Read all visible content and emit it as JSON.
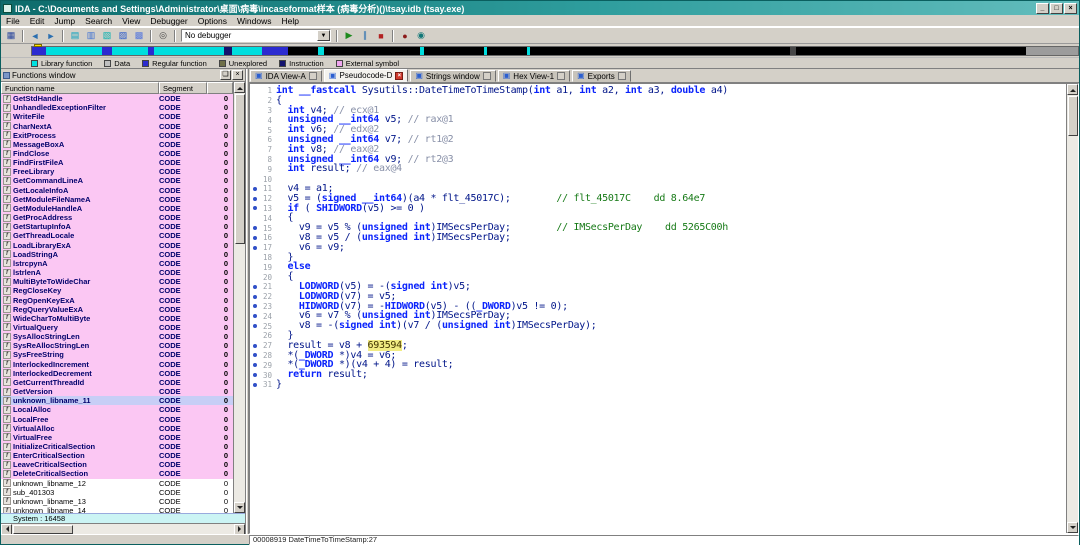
{
  "window": {
    "title": "IDA - C:\\Documents and Settings\\Administrator\\桌面\\病毒\\incaseformat样本 (病毒分析)()\\tsay.idb (tsay.exe)",
    "controls": [
      {
        "name": "minimize-button",
        "glyph": "_"
      },
      {
        "name": "maximize-button",
        "glyph": "□"
      },
      {
        "name": "close-button",
        "glyph": "×"
      }
    ]
  },
  "menu": {
    "items": [
      "File",
      "Edit",
      "Jump",
      "Search",
      "View",
      "Debugger",
      "Options",
      "Windows",
      "Help"
    ]
  },
  "toolbar": {
    "no_debugger": "No debugger",
    "combo_arrow": "▼",
    "items": [
      {
        "name": "save-icon",
        "glyph": "▦",
        "color": "#28459c"
      },
      {
        "sep": true
      },
      {
        "name": "back-icon",
        "glyph": "◄",
        "color": "#2b6fb0"
      },
      {
        "name": "forward-icon",
        "glyph": "►",
        "color": "#2b6fb0"
      },
      {
        "sep": true
      },
      {
        "name": "disasm-view-icon",
        "glyph": "▤",
        "color": "#00a0c0"
      },
      {
        "name": "hex-view-icon",
        "glyph": "▥",
        "color": "#3b6fd4"
      },
      {
        "name": "structures-view-icon",
        "glyph": "▧",
        "color": "#00b0b0"
      },
      {
        "name": "enums-view-icon",
        "glyph": "▨",
        "color": "#2255cc"
      },
      {
        "name": "imports-view-icon",
        "glyph": "▩",
        "color": "#5577dd"
      },
      {
        "sep": true
      },
      {
        "name": "search-icon",
        "glyph": "◎",
        "color": "#444444"
      },
      {
        "sep": true
      },
      {
        "combo": true
      },
      {
        "sep": true
      },
      {
        "name": "start-process-icon",
        "glyph": "▶",
        "color": "#1e8a1e"
      },
      {
        "name": "pause-process-icon",
        "glyph": "∥",
        "color": "#2b6fb0"
      },
      {
        "name": "stop-process-icon",
        "glyph": "■",
        "color": "#b22222"
      },
      {
        "sep": true
      },
      {
        "name": "breakpoints-icon",
        "glyph": "●",
        "color": "#8b1a1a"
      },
      {
        "name": "watches-icon",
        "glyph": "◉",
        "color": "#117777"
      }
    ]
  },
  "nav_band": {
    "segments": [
      [
        "#2b2bd0",
        14
      ],
      [
        "#00dede",
        56
      ],
      [
        "#2b2bd0",
        10
      ],
      [
        "#00dede",
        36
      ],
      [
        "#2b2bd0",
        6
      ],
      [
        "#00dede",
        70
      ],
      [
        "#14146e",
        8
      ],
      [
        "#00dede",
        30
      ],
      [
        "#2b2bd0",
        26
      ],
      [
        "#000000",
        30
      ],
      [
        "#00dede",
        6
      ],
      [
        "#000000",
        96
      ],
      [
        "#00dede",
        4
      ],
      [
        "#000000",
        60
      ],
      [
        "#00dede",
        3
      ],
      [
        "#000000",
        40
      ],
      [
        "#00dede",
        3
      ],
      [
        "#000000",
        260
      ],
      [
        "#464646",
        6
      ],
      [
        "#000000",
        230
      ],
      [
        "#9c9c9c",
        54
      ]
    ]
  },
  "legend": {
    "items": [
      {
        "label": "Library function",
        "color": "#00E0E0"
      },
      {
        "label": "Data",
        "color": "#BFBFBF"
      },
      {
        "label": "Regular function",
        "color": "#2B2BD0"
      },
      {
        "label": "Unexplored",
        "color": "#6E6E46"
      },
      {
        "label": "Instruction",
        "color": "#14146E"
      },
      {
        "label": "External symbol",
        "color": "#F0A6F0"
      }
    ]
  },
  "functions_panel": {
    "title": "Functions window",
    "columns": [
      "Function name",
      "Segment",
      ""
    ],
    "row_icon": "f",
    "buttons": [
      {
        "name": "panel-float-button",
        "glyph": "❏"
      },
      {
        "name": "panel-close-button",
        "glyph": "×"
      }
    ],
    "footer": "System : 16458",
    "rows": [
      [
        "GetStdHandle",
        "CODE",
        "0",
        "lib"
      ],
      [
        "UnhandledExceptionFilter",
        "CODE",
        "0",
        "lib"
      ],
      [
        "WriteFile",
        "CODE",
        "0",
        "lib"
      ],
      [
        "CharNextA",
        "CODE",
        "0",
        "lib"
      ],
      [
        "ExitProcess",
        "CODE",
        "0",
        "lib"
      ],
      [
        "MessageBoxA",
        "CODE",
        "0",
        "lib"
      ],
      [
        "FindClose",
        "CODE",
        "0",
        "lib"
      ],
      [
        "FindFirstFileA",
        "CODE",
        "0",
        "lib"
      ],
      [
        "FreeLibrary",
        "CODE",
        "0",
        "lib"
      ],
      [
        "GetCommandLineA",
        "CODE",
        "0",
        "lib"
      ],
      [
        "GetLocaleInfoA",
        "CODE",
        "0",
        "lib"
      ],
      [
        "GetModuleFileNameA",
        "CODE",
        "0",
        "lib"
      ],
      [
        "GetModuleHandleA",
        "CODE",
        "0",
        "lib"
      ],
      [
        "GetProcAddress",
        "CODE",
        "0",
        "lib"
      ],
      [
        "GetStartupInfoA",
        "CODE",
        "0",
        "lib"
      ],
      [
        "GetThreadLocale",
        "CODE",
        "0",
        "lib"
      ],
      [
        "LoadLibraryExA",
        "CODE",
        "0",
        "lib"
      ],
      [
        "LoadStringA",
        "CODE",
        "0",
        "lib"
      ],
      [
        "lstrcpynA",
        "CODE",
        "0",
        "lib"
      ],
      [
        "lstrlenA",
        "CODE",
        "0",
        "lib"
      ],
      [
        "MultiByteToWideChar",
        "CODE",
        "0",
        "lib"
      ],
      [
        "RegCloseKey",
        "CODE",
        "0",
        "lib"
      ],
      [
        "RegOpenKeyExA",
        "CODE",
        "0",
        "lib"
      ],
      [
        "RegQueryValueExA",
        "CODE",
        "0",
        "lib"
      ],
      [
        "WideCharToMultiByte",
        "CODE",
        "0",
        "lib"
      ],
      [
        "VirtualQuery",
        "CODE",
        "0",
        "lib"
      ],
      [
        "SysAllocStringLen",
        "CODE",
        "0",
        "lib"
      ],
      [
        "SysReAllocStringLen",
        "CODE",
        "0",
        "lib"
      ],
      [
        "SysFreeString",
        "CODE",
        "0",
        "lib"
      ],
      [
        "InterlockedIncrement",
        "CODE",
        "0",
        "lib"
      ],
      [
        "InterlockedDecrement",
        "CODE",
        "0",
        "lib"
      ],
      [
        "GetCurrentThreadId",
        "CODE",
        "0",
        "lib"
      ],
      [
        "GetVersion",
        "CODE",
        "0",
        "lib"
      ],
      [
        "unknown_libname_11",
        "CODE",
        "0",
        "sel"
      ],
      [
        "LocalAlloc",
        "CODE",
        "0",
        "lib"
      ],
      [
        "LocalFree",
        "CODE",
        "0",
        "lib"
      ],
      [
        "VirtualAlloc",
        "CODE",
        "0",
        "lib"
      ],
      [
        "VirtualFree",
        "CODE",
        "0",
        "lib"
      ],
      [
        "InitializeCriticalSection",
        "CODE",
        "0",
        "lib"
      ],
      [
        "EnterCriticalSection",
        "CODE",
        "0",
        "lib"
      ],
      [
        "LeaveCriticalSection",
        "CODE",
        "0",
        "lib"
      ],
      [
        "DeleteCriticalSection",
        "CODE",
        "0",
        "lib"
      ],
      [
        "unknown_libname_12",
        "CODE",
        "0",
        "plain"
      ],
      [
        "sub_401303",
        "CODE",
        "0",
        "plain"
      ],
      [
        "unknown_libname_13",
        "CODE",
        "0",
        "plain"
      ],
      [
        "unknown_libname_14",
        "CODE",
        "0",
        "plain"
      ]
    ]
  },
  "tabs_meta": {
    "icon_glyph": "▣",
    "close_glyph": "×"
  },
  "tabs": [
    {
      "label": "IDA View-A",
      "active": false
    },
    {
      "label": "Pseudocode-D",
      "active": true
    },
    {
      "label": "Strings window",
      "active": false
    },
    {
      "label": "Hex View-1",
      "active": false
    },
    {
      "label": "Exports",
      "active": false
    }
  ],
  "pseudocode": {
    "keywords": [
      "__fastcall",
      "__int64",
      "unsigned",
      "signed",
      "double",
      "return",
      "SHIDWORD",
      "LODWORD",
      "HIDWORD",
      "_DWORD",
      "else",
      "int",
      "if"
    ],
    "highlight": "693594",
    "lines": [
      {
        "n": 1,
        "dot": 0,
        "t": "int __fastcall Sysutils::DateTimeToTimeStamp(int a1, int a2, int a3, double a4)"
      },
      {
        "n": 2,
        "dot": 0,
        "t": "{"
      },
      {
        "n": 3,
        "dot": 0,
        "t": "  int v4; // ecx@1"
      },
      {
        "n": 4,
        "dot": 0,
        "t": "  unsigned __int64 v5; // rax@1"
      },
      {
        "n": 5,
        "dot": 0,
        "t": "  int v6; // edx@2"
      },
      {
        "n": 6,
        "dot": 0,
        "t": "  unsigned __int64 v7; // rt1@2"
      },
      {
        "n": 7,
        "dot": 0,
        "t": "  int v8; // eax@2"
      },
      {
        "n": 8,
        "dot": 0,
        "t": "  unsigned __int64 v9; // rt2@3"
      },
      {
        "n": 9,
        "dot": 0,
        "t": "  int result; // eax@4"
      },
      {
        "n": 10,
        "dot": 0,
        "t": ""
      },
      {
        "n": 11,
        "dot": 1,
        "t": "  v4 = a1;"
      },
      {
        "n": 12,
        "dot": 1,
        "t": "  v5 = (signed __int64)(a4 * flt_45017C);        // flt_45017C    dd 8.64e7"
      },
      {
        "n": 13,
        "dot": 1,
        "t": "  if ( SHIDWORD(v5) >= 0 )"
      },
      {
        "n": 14,
        "dot": 0,
        "t": "  {"
      },
      {
        "n": 15,
        "dot": 1,
        "t": "    v9 = v5 % (unsigned int)IMSecsPerDay;        // IMSecsPerDay    dd 5265C00h"
      },
      {
        "n": 16,
        "dot": 1,
        "t": "    v8 = v5 / (unsigned int)IMSecsPerDay;"
      },
      {
        "n": 17,
        "dot": 1,
        "t": "    v6 = v9;"
      },
      {
        "n": 18,
        "dot": 0,
        "t": "  }"
      },
      {
        "n": 19,
        "dot": 0,
        "t": "  else"
      },
      {
        "n": 20,
        "dot": 0,
        "t": "  {"
      },
      {
        "n": 21,
        "dot": 1,
        "t": "    LODWORD(v5) = -(signed int)v5;"
      },
      {
        "n": 22,
        "dot": 1,
        "t": "    LODWORD(v7) = v5;"
      },
      {
        "n": 23,
        "dot": 1,
        "t": "    HIDWORD(v7) = -HIDWORD(v5) - ((_DWORD)v5 != 0);"
      },
      {
        "n": 24,
        "dot": 1,
        "t": "    v6 = v7 % (unsigned int)IMSecsPerDay;"
      },
      {
        "n": 25,
        "dot": 1,
        "t": "    v8 = -(signed int)(v7 / (unsigned int)IMSecsPerDay);"
      },
      {
        "n": 26,
        "dot": 0,
        "t": "  }"
      },
      {
        "n": 27,
        "dot": 1,
        "t": "  result = v8 + 693594;"
      },
      {
        "n": 28,
        "dot": 1,
        "t": "  *(_DWORD *)v4 = v6;"
      },
      {
        "n": 29,
        "dot": 1,
        "t": "  *(_DWORD *)(v4 + 4) = result;"
      },
      {
        "n": 30,
        "dot": 1,
        "t": "  return result;"
      },
      {
        "n": 31,
        "dot": 1,
        "t": "}"
      }
    ]
  },
  "status_bar": {
    "text": "00008919 DateTimeToTimeStamp:27"
  }
}
